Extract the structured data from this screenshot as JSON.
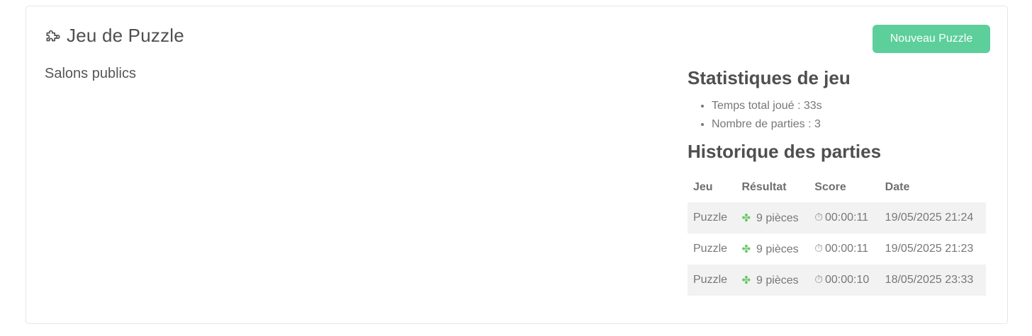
{
  "header": {
    "title": "Jeu de Puzzle",
    "new_button_label": "Nouveau Puzzle",
    "accent_color": "#5ccf9b"
  },
  "left": {
    "section_title": "Salons publics"
  },
  "stats": {
    "title": "Statistiques de jeu",
    "items": [
      "Temps total joué : 33s",
      "Nombre de parties : 3"
    ]
  },
  "history": {
    "title": "Historique des parties",
    "columns": [
      "Jeu",
      "Résultat",
      "Score",
      "Date"
    ],
    "rows": [
      {
        "game": "Puzzle",
        "result_icon": "puzzle-piece-icon",
        "result": "9 pièces",
        "score_icon": "stopwatch-icon",
        "score": "00:00:11",
        "date": "19/05/2025 21:24"
      },
      {
        "game": "Puzzle",
        "result_icon": "puzzle-piece-icon",
        "result": "9 pièces",
        "score_icon": "stopwatch-icon",
        "score": "00:00:11",
        "date": "19/05/2025 21:23"
      },
      {
        "game": "Puzzle",
        "result_icon": "puzzle-piece-icon",
        "result": "9 pièces",
        "score_icon": "stopwatch-icon",
        "score": "00:00:10",
        "date": "18/05/2025 23:33"
      }
    ]
  }
}
